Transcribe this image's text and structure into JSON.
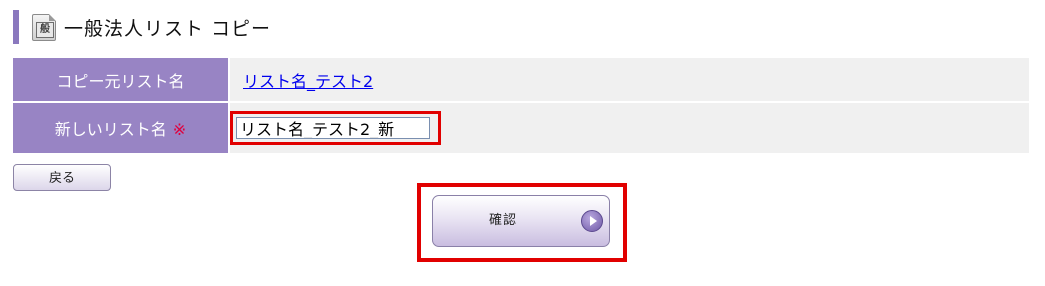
{
  "header": {
    "icon_glyph": "般",
    "title": "一般法人リスト コピー"
  },
  "form": {
    "rows": [
      {
        "label": "コピー元リスト名",
        "value": "リスト名_テスト2"
      },
      {
        "label": "新しいリスト名",
        "required_mark": "※",
        "input_value": "リスト名_テスト2_新"
      }
    ]
  },
  "buttons": {
    "back_label": "戻る",
    "confirm_label": "確認"
  },
  "colors": {
    "accent": "#9884c4",
    "highlight": "#e10000",
    "required": "#e0003c"
  },
  "icons": {
    "title_icon": "document-icon",
    "confirm_icon": "play-circle-icon"
  }
}
